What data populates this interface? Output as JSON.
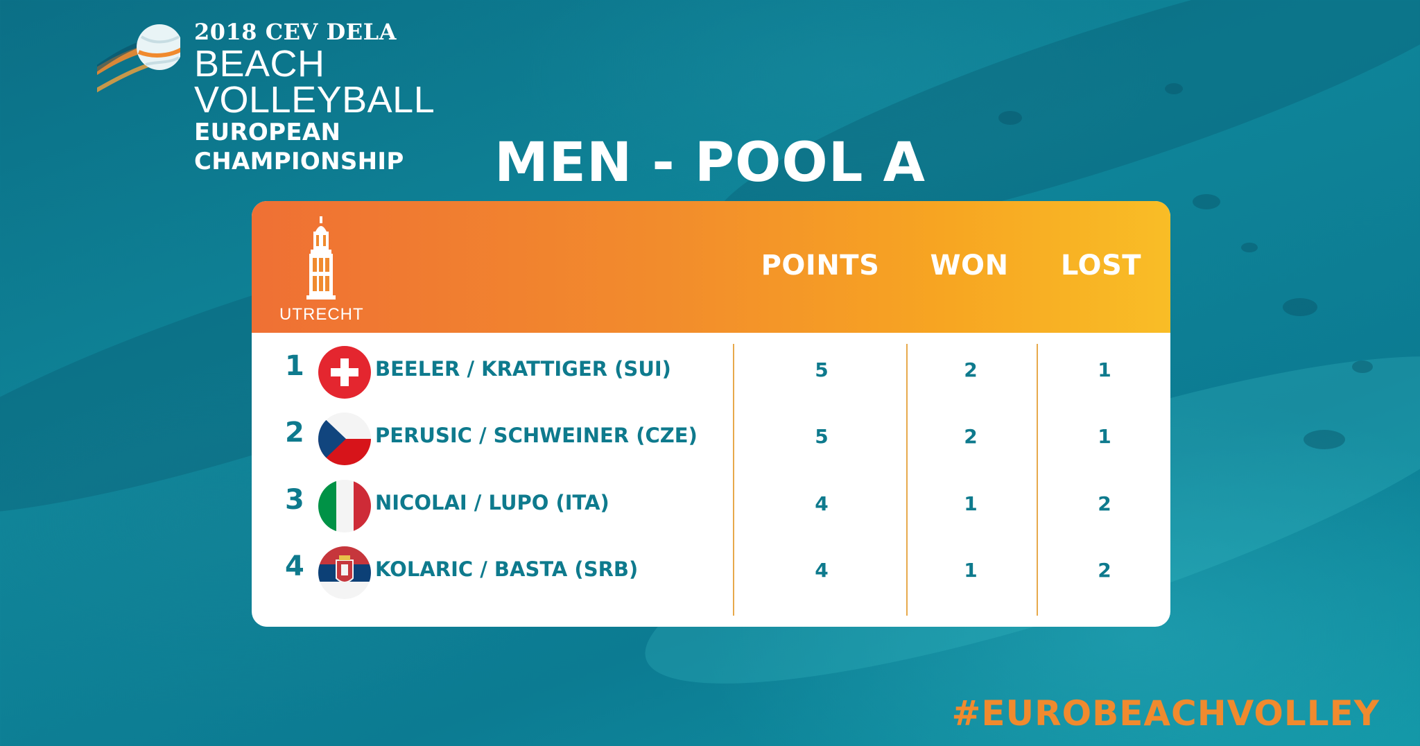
{
  "logo": {
    "line1": "2018 CEV DELA",
    "line2": "BEACH VOLLEYBALL",
    "line3": "EUROPEAN CHAMPIONSHIP"
  },
  "title": "MEN - POOL A",
  "table": {
    "city": "UTRECHT",
    "columns": [
      "POINTS",
      "WON",
      "LOST"
    ],
    "rows": [
      {
        "rank": "1",
        "team": "BEELER / KRATTIGER (SUI)",
        "flag": "switzerland-flag-icon",
        "points": "5",
        "won": "2",
        "lost": "1"
      },
      {
        "rank": "2",
        "team": "PERUSIC / SCHWEINER (CZE)",
        "flag": "czech-flag-icon",
        "points": "5",
        "won": "2",
        "lost": "1"
      },
      {
        "rank": "3",
        "team": "NICOLAI / LUPO (ITA)",
        "flag": "italy-flag-icon",
        "points": "4",
        "won": "1",
        "lost": "2"
      },
      {
        "rank": "4",
        "team": "KOLARIC / BASTA (SRB)",
        "flag": "serbia-flag-icon",
        "points": "4",
        "won": "1",
        "lost": "2"
      }
    ]
  },
  "hashtag": "#EUROBEACHVOLLEY",
  "colors": {
    "background": "#0f8599",
    "header_start": "#ef7034",
    "header_end": "#f9bd26",
    "text_teal": "#0e7a8d",
    "hashtag": "#f08a2e"
  }
}
